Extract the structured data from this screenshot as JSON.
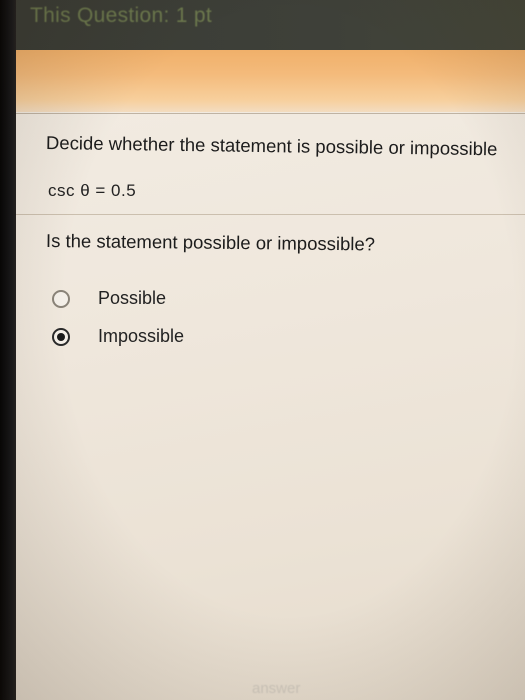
{
  "header": {
    "title": "This Question: 1 pt"
  },
  "problem": {
    "instruction": "Decide whether the statement is possible or impossible",
    "equation": "csc θ = 0.5",
    "question": "Is the statement possible or impossible?"
  },
  "options": [
    {
      "label": "Possible",
      "selected": false
    },
    {
      "label": "Impossible",
      "selected": true
    }
  ],
  "footer": {
    "faint_text": "answer"
  }
}
